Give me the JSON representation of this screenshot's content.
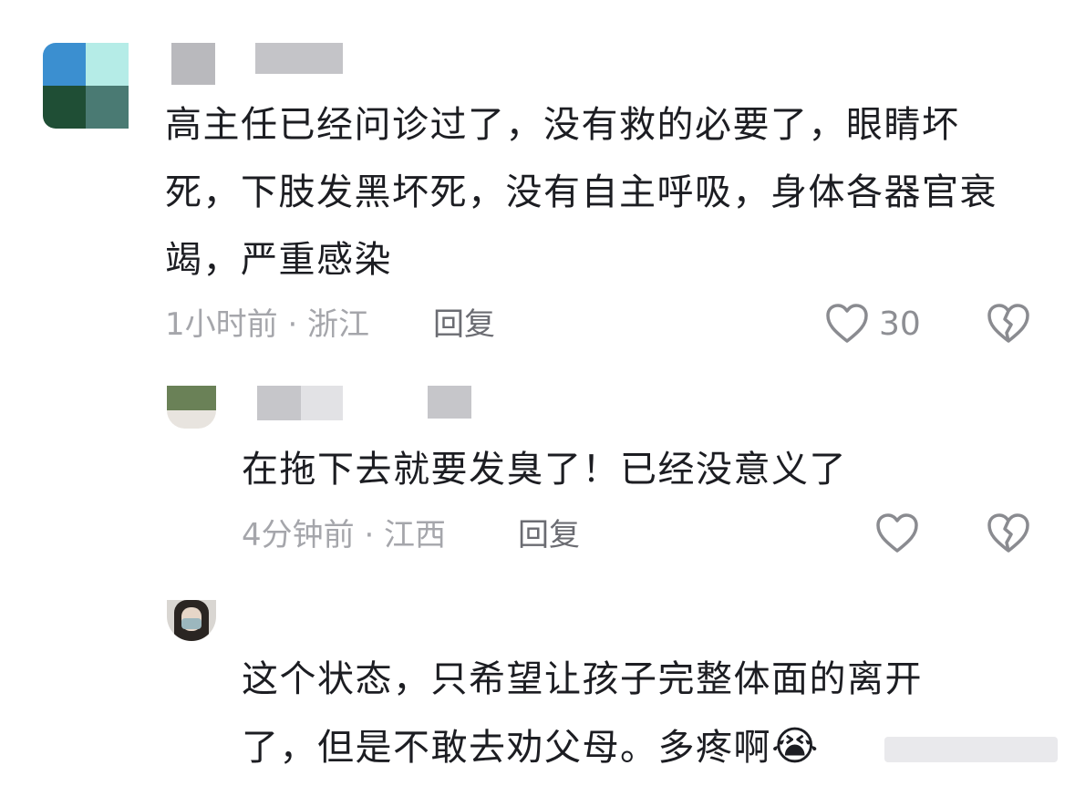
{
  "comments": [
    {
      "text": "高主任已经问诊过了，没有救的必要了，眼睛坏死，下肢发黑坏死，没有自主呼吸，身体各器官衰竭，严重感染",
      "time": "1小时前 · 浙江",
      "reply_label": "回复",
      "likes": "30"
    },
    {
      "text": "在拖下去就要发臭了！已经没意义了",
      "time": "4分钟前 · 江西",
      "reply_label": "回复",
      "likes": ""
    },
    {
      "text": "这个状态，只希望让孩子完整体面的离开了，但是不敢去劝父母。多疼啊",
      "emoji": "😭"
    }
  ],
  "colors": {
    "text": "#1c1d22",
    "meta": "#a5a6ab",
    "icon": "#8a8b90"
  },
  "icons": [
    "heart-icon",
    "broken-heart-icon"
  ]
}
